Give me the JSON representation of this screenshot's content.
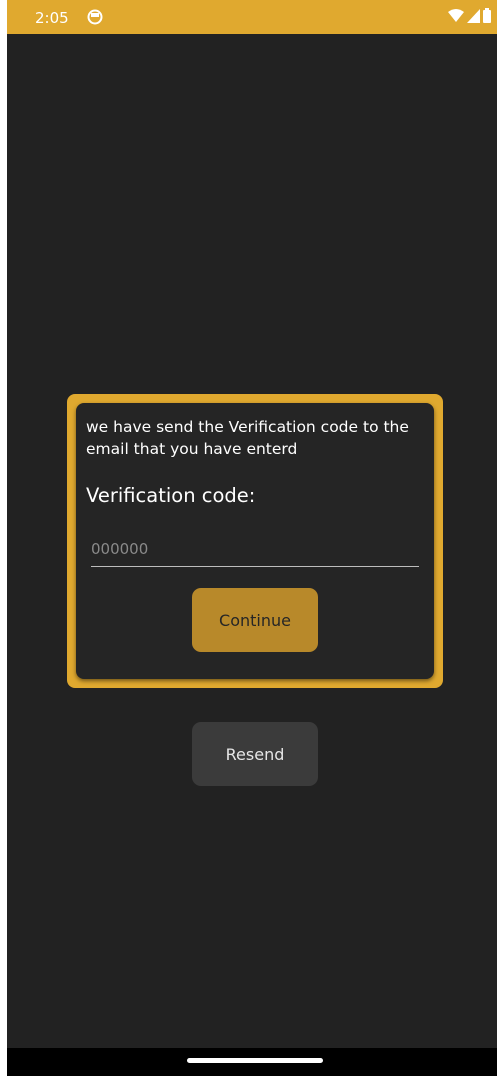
{
  "status_bar": {
    "time": "2:05",
    "app_icon": "app-status-icon",
    "icons": [
      "wifi-icon",
      "signal-icon",
      "battery-icon"
    ],
    "background_color": "#e0a92f"
  },
  "verification": {
    "message": "we have send the Verification code to the email that you have enterd",
    "label": "Verification code:",
    "code_placeholder": "000000",
    "code_value": "",
    "continue_label": "Continue",
    "accent_color": "#e0a92f"
  },
  "resend_label": "Resend",
  "colors": {
    "background": "#222222",
    "continue_button": "#b8892a",
    "resend_button": "#3b3b3b"
  }
}
